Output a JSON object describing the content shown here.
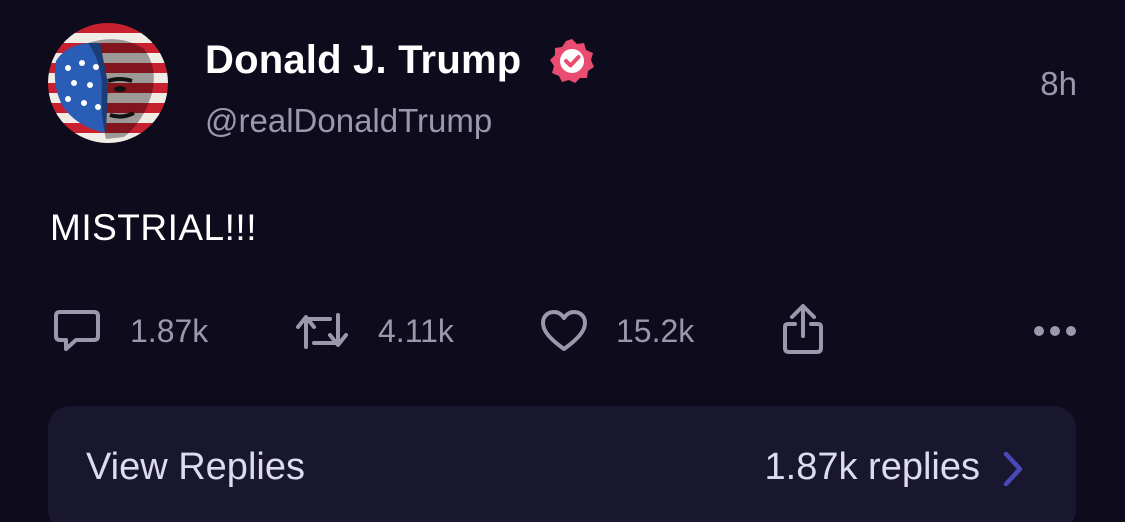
{
  "author": {
    "display_name": "Donald J. Trump",
    "handle": "@realDonaldTrump",
    "verified": true,
    "avatar_icon": "flag-painted-portrait-avatar"
  },
  "timestamp": "8h",
  "post_text": "MISTRIAL!!!",
  "actions": {
    "replies": "1.87k",
    "reposts": "4.11k",
    "likes": "15.2k",
    "share_icon": "share-icon",
    "more_icon": "more-icon"
  },
  "view_replies": {
    "label": "View Replies",
    "count": "1.87k replies"
  },
  "colors": {
    "background": "#0e0b1c",
    "secondary_text": "#9b98ae",
    "verified_badge": "#ea4c6f",
    "replies_bar": "#191630",
    "chevron": "#4b49b8"
  }
}
